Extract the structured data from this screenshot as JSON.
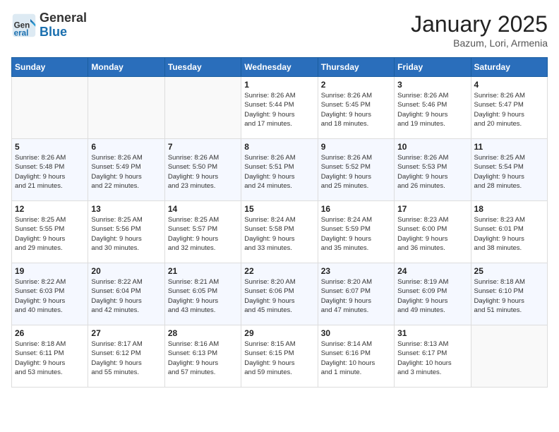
{
  "header": {
    "logo_general": "General",
    "logo_blue": "Blue",
    "month_title": "January 2025",
    "location": "Bazum, Lori, Armenia"
  },
  "weekdays": [
    "Sunday",
    "Monday",
    "Tuesday",
    "Wednesday",
    "Thursday",
    "Friday",
    "Saturday"
  ],
  "weeks": [
    [
      {
        "day": "",
        "info": ""
      },
      {
        "day": "",
        "info": ""
      },
      {
        "day": "",
        "info": ""
      },
      {
        "day": "1",
        "info": "Sunrise: 8:26 AM\nSunset: 5:44 PM\nDaylight: 9 hours\nand 17 minutes."
      },
      {
        "day": "2",
        "info": "Sunrise: 8:26 AM\nSunset: 5:45 PM\nDaylight: 9 hours\nand 18 minutes."
      },
      {
        "day": "3",
        "info": "Sunrise: 8:26 AM\nSunset: 5:46 PM\nDaylight: 9 hours\nand 19 minutes."
      },
      {
        "day": "4",
        "info": "Sunrise: 8:26 AM\nSunset: 5:47 PM\nDaylight: 9 hours\nand 20 minutes."
      }
    ],
    [
      {
        "day": "5",
        "info": "Sunrise: 8:26 AM\nSunset: 5:48 PM\nDaylight: 9 hours\nand 21 minutes."
      },
      {
        "day": "6",
        "info": "Sunrise: 8:26 AM\nSunset: 5:49 PM\nDaylight: 9 hours\nand 22 minutes."
      },
      {
        "day": "7",
        "info": "Sunrise: 8:26 AM\nSunset: 5:50 PM\nDaylight: 9 hours\nand 23 minutes."
      },
      {
        "day": "8",
        "info": "Sunrise: 8:26 AM\nSunset: 5:51 PM\nDaylight: 9 hours\nand 24 minutes."
      },
      {
        "day": "9",
        "info": "Sunrise: 8:26 AM\nSunset: 5:52 PM\nDaylight: 9 hours\nand 25 minutes."
      },
      {
        "day": "10",
        "info": "Sunrise: 8:26 AM\nSunset: 5:53 PM\nDaylight: 9 hours\nand 26 minutes."
      },
      {
        "day": "11",
        "info": "Sunrise: 8:25 AM\nSunset: 5:54 PM\nDaylight: 9 hours\nand 28 minutes."
      }
    ],
    [
      {
        "day": "12",
        "info": "Sunrise: 8:25 AM\nSunset: 5:55 PM\nDaylight: 9 hours\nand 29 minutes."
      },
      {
        "day": "13",
        "info": "Sunrise: 8:25 AM\nSunset: 5:56 PM\nDaylight: 9 hours\nand 30 minutes."
      },
      {
        "day": "14",
        "info": "Sunrise: 8:25 AM\nSunset: 5:57 PM\nDaylight: 9 hours\nand 32 minutes."
      },
      {
        "day": "15",
        "info": "Sunrise: 8:24 AM\nSunset: 5:58 PM\nDaylight: 9 hours\nand 33 minutes."
      },
      {
        "day": "16",
        "info": "Sunrise: 8:24 AM\nSunset: 5:59 PM\nDaylight: 9 hours\nand 35 minutes."
      },
      {
        "day": "17",
        "info": "Sunrise: 8:23 AM\nSunset: 6:00 PM\nDaylight: 9 hours\nand 36 minutes."
      },
      {
        "day": "18",
        "info": "Sunrise: 8:23 AM\nSunset: 6:01 PM\nDaylight: 9 hours\nand 38 minutes."
      }
    ],
    [
      {
        "day": "19",
        "info": "Sunrise: 8:22 AM\nSunset: 6:03 PM\nDaylight: 9 hours\nand 40 minutes."
      },
      {
        "day": "20",
        "info": "Sunrise: 8:22 AM\nSunset: 6:04 PM\nDaylight: 9 hours\nand 42 minutes."
      },
      {
        "day": "21",
        "info": "Sunrise: 8:21 AM\nSunset: 6:05 PM\nDaylight: 9 hours\nand 43 minutes."
      },
      {
        "day": "22",
        "info": "Sunrise: 8:20 AM\nSunset: 6:06 PM\nDaylight: 9 hours\nand 45 minutes."
      },
      {
        "day": "23",
        "info": "Sunrise: 8:20 AM\nSunset: 6:07 PM\nDaylight: 9 hours\nand 47 minutes."
      },
      {
        "day": "24",
        "info": "Sunrise: 8:19 AM\nSunset: 6:09 PM\nDaylight: 9 hours\nand 49 minutes."
      },
      {
        "day": "25",
        "info": "Sunrise: 8:18 AM\nSunset: 6:10 PM\nDaylight: 9 hours\nand 51 minutes."
      }
    ],
    [
      {
        "day": "26",
        "info": "Sunrise: 8:18 AM\nSunset: 6:11 PM\nDaylight: 9 hours\nand 53 minutes."
      },
      {
        "day": "27",
        "info": "Sunrise: 8:17 AM\nSunset: 6:12 PM\nDaylight: 9 hours\nand 55 minutes."
      },
      {
        "day": "28",
        "info": "Sunrise: 8:16 AM\nSunset: 6:13 PM\nDaylight: 9 hours\nand 57 minutes."
      },
      {
        "day": "29",
        "info": "Sunrise: 8:15 AM\nSunset: 6:15 PM\nDaylight: 9 hours\nand 59 minutes."
      },
      {
        "day": "30",
        "info": "Sunrise: 8:14 AM\nSunset: 6:16 PM\nDaylight: 10 hours\nand 1 minute."
      },
      {
        "day": "31",
        "info": "Sunrise: 8:13 AM\nSunset: 6:17 PM\nDaylight: 10 hours\nand 3 minutes."
      },
      {
        "day": "",
        "info": ""
      }
    ]
  ]
}
